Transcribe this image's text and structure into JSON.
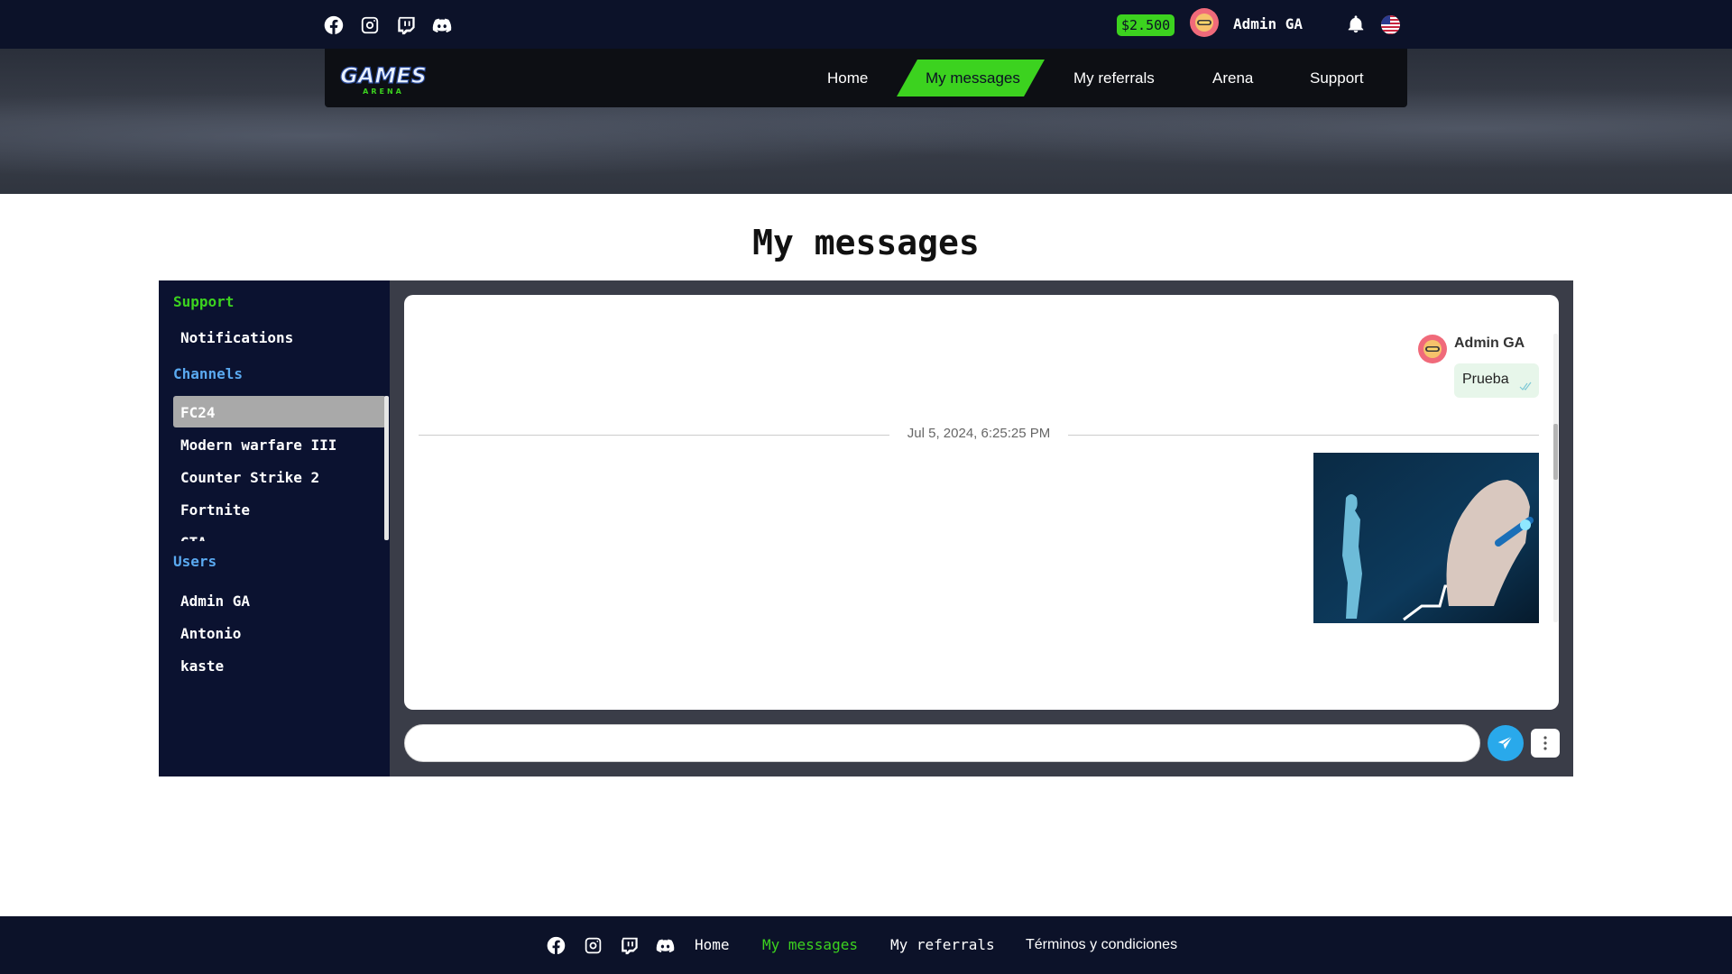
{
  "topbar": {
    "social": [
      "facebook-icon",
      "instagram-icon",
      "twitch-icon",
      "discord-icon"
    ],
    "balance": "$2.500",
    "user_name": "Admin GA",
    "language": "en-US"
  },
  "nav": {
    "logo_text": "GAMES",
    "logo_subtext": "ARENA",
    "items": [
      {
        "label": "Home",
        "active": false
      },
      {
        "label": "My messages",
        "active": true
      },
      {
        "label": "My referrals",
        "active": false
      },
      {
        "label": "Arena",
        "active": false
      },
      {
        "label": "Support",
        "active": false
      }
    ]
  },
  "page": {
    "title": "My messages"
  },
  "sidebar": {
    "support_heading": "Support",
    "support_items": [
      "Notifications"
    ],
    "channels_heading": "Channels",
    "channels": [
      "FC24",
      "Modern warfare III",
      "Counter Strike 2",
      "Fortnite",
      "GTA"
    ],
    "users_heading": "Users",
    "users": [
      "Admin GA",
      "Antonio",
      "kaste"
    ]
  },
  "chat": {
    "message": {
      "author": "Admin GA",
      "text": "Prueba"
    },
    "date_separator": "Jul 5, 2024, 6:25:25 PM",
    "input_placeholder": ""
  },
  "footer": {
    "social": [
      "facebook-icon",
      "instagram-icon",
      "twitch-icon",
      "discord-icon"
    ],
    "links": [
      "Home",
      "My messages",
      "My referrals",
      "Términos y condiciones"
    ]
  },
  "colors": {
    "dark_bg": "#0c1229",
    "accent_green": "#3cd21f",
    "channel_blue": "#5aa9f0",
    "send_blue": "#29a9eb"
  }
}
